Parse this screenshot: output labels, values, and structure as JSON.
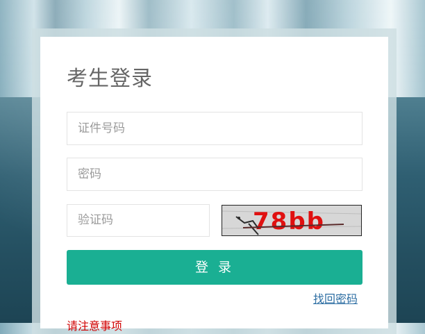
{
  "login": {
    "title": "考生登录",
    "id_placeholder": "证件号码",
    "password_placeholder": "密码",
    "captcha_placeholder": "验证码",
    "captcha_text": "78bb",
    "submit_label": "登 录",
    "forgot_password": "找回密码",
    "notice_text": "请注意事项"
  },
  "colors": {
    "primary_button": "#1aaf93",
    "link": "#2d6ea3",
    "notice": "#d00000"
  }
}
